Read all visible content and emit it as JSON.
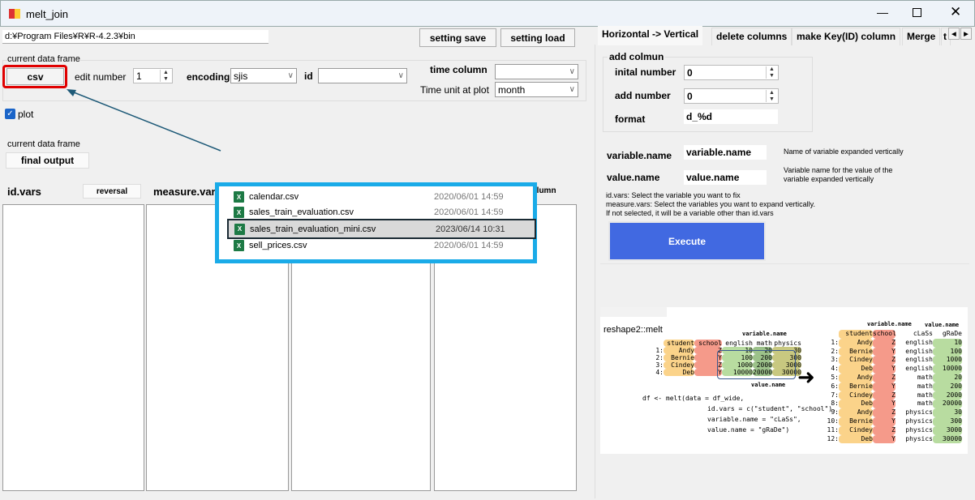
{
  "window": {
    "title": "melt_join",
    "controls": [
      "minimize",
      "maximize",
      "close"
    ]
  },
  "top": {
    "path_value": "d:¥Program Files¥R¥R-4.2.3¥bin",
    "setting_save": "setting save",
    "setting_load": "setting load"
  },
  "frame_group": {
    "label": "current data frame",
    "csv": "csv",
    "edit_number_label": "edit number",
    "edit_number_value": "1",
    "encoding_label": "encoding",
    "encoding_value": "sjis",
    "id_label": "id",
    "id_value": "",
    "time_column_label": "time column",
    "time_column_value": "",
    "time_unit_label": "Time unit at plot",
    "time_unit_value": "month"
  },
  "plot": {
    "label": "plot",
    "checked": true
  },
  "final": {
    "label": "current data frame",
    "button": "final output"
  },
  "lists": {
    "id_vars": "id.vars",
    "reversal": "reversal",
    "measure_vars": "measure.var",
    "fourth": "column"
  },
  "file_popup": {
    "files": [
      {
        "name": "calendar.csv",
        "date": "2020/06/01 14:59",
        "selected": false
      },
      {
        "name": "sales_train_evaluation.csv",
        "date": "2020/06/01 14:59",
        "selected": false
      },
      {
        "name": "sales_train_evaluation_mini.csv",
        "date": "2023/06/14 10:31",
        "selected": true
      },
      {
        "name": "sell_prices.csv",
        "date": "2020/06/01 14:59",
        "selected": false
      }
    ]
  },
  "tabs": [
    {
      "label": "Horizontal -> Vertical",
      "active": true
    },
    {
      "label": "delete columns"
    },
    {
      "label": "make Key(ID) column"
    },
    {
      "label": "Merge"
    },
    {
      "label": "t"
    }
  ],
  "right": {
    "add_group": "add colmun",
    "inital_number_label": "inital number",
    "inital_number_value": "0",
    "add_number_label": "add number",
    "add_number_value": "0",
    "format_label": "format",
    "format_value": "d_%d",
    "variable_name_label": "variable.name",
    "variable_name_value": "variable.name",
    "variable_name_help": "Name of variable expanded vertically",
    "value_name_label": "value.name",
    "value_name_value": "value.name",
    "value_name_help": "Variable name for the value of the variable expanded vertically",
    "help1": "id.vars: Select the variable you want to fix",
    "help2": "measure.vars: Select the variables you want to expand vertically.",
    "help3": "If not selected, it will be a variable other than id.vars",
    "execute": "Execute"
  },
  "illustration": {
    "title": "reshape2::melt",
    "variable_name": "variable.name",
    "value_name": "value.name",
    "wide_header": [
      "student",
      "school",
      "english",
      "math",
      "physics"
    ],
    "wide_rows": [
      [
        "1:",
        "Andy",
        "Z",
        "10",
        "20",
        "30"
      ],
      [
        "2:",
        "Bernie",
        "Y",
        "100",
        "200",
        "300"
      ],
      [
        "3:",
        "Cindey",
        "Z",
        "1000",
        "2000",
        "3000"
      ],
      [
        "4:",
        "Deb",
        "Y",
        "10000",
        "20000",
        "30000"
      ]
    ],
    "code": [
      "df <- melt(data = df_wide,",
      "id.vars = c(\"student\", \"school\"),",
      "variable.name = \"cLaSs\",",
      "value.name = \"gRaDe\")"
    ],
    "long_header": [
      "student",
      "school",
      "cLaSs",
      "gRaDe"
    ],
    "long_rows": [
      [
        "1:",
        "Andy",
        "Z",
        "english",
        "10"
      ],
      [
        "2:",
        "Bernie",
        "Y",
        "english",
        "100"
      ],
      [
        "3:",
        "Cindey",
        "Z",
        "english",
        "1000"
      ],
      [
        "4:",
        "Deb",
        "Y",
        "english",
        "10000"
      ],
      [
        "5:",
        "Andy",
        "Z",
        "math",
        "20"
      ],
      [
        "6:",
        "Bernie",
        "Y",
        "math",
        "200"
      ],
      [
        "7:",
        "Cindey",
        "Z",
        "math",
        "2000"
      ],
      [
        "8:",
        "Deb",
        "Y",
        "math",
        "20000"
      ],
      [
        "9:",
        "Andy",
        "Z",
        "physics",
        "30"
      ],
      [
        "10:",
        "Bernie",
        "Y",
        "physics",
        "300"
      ],
      [
        "11:",
        "Cindey",
        "Z",
        "physics",
        "3000"
      ],
      [
        "12:",
        "Deb",
        "Y",
        "physics",
        "30000"
      ]
    ]
  },
  "colors": {
    "accent": "#4169e1",
    "highlight_red": "#e00000",
    "popup_border": "#1aabe8",
    "arrow": "#1e5a78"
  }
}
